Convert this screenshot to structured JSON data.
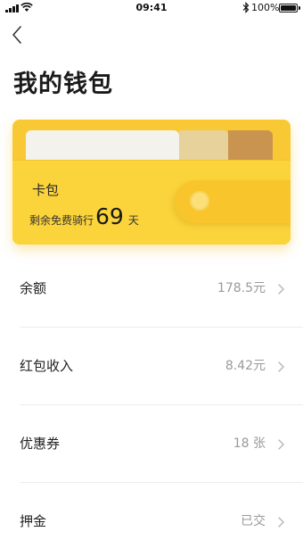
{
  "status_bar": {
    "time": "09:41",
    "battery": "100%"
  },
  "header": {
    "title": "我的钱包"
  },
  "card": {
    "title": "卡包",
    "subtitle_prefix": "剩余免费骑行",
    "days": "69",
    "unit": "天"
  },
  "items": [
    {
      "label": "余额",
      "value": "178.5元"
    },
    {
      "label": "红包收入",
      "value": "8.42元"
    },
    {
      "label": "优惠券",
      "value": "18 张"
    },
    {
      "label": "押金",
      "value": "已交"
    }
  ],
  "colors": {
    "card_yellow": "#fbd33a",
    "card_shadow": "#f8c935",
    "value_gray": "#9a9a9a"
  }
}
